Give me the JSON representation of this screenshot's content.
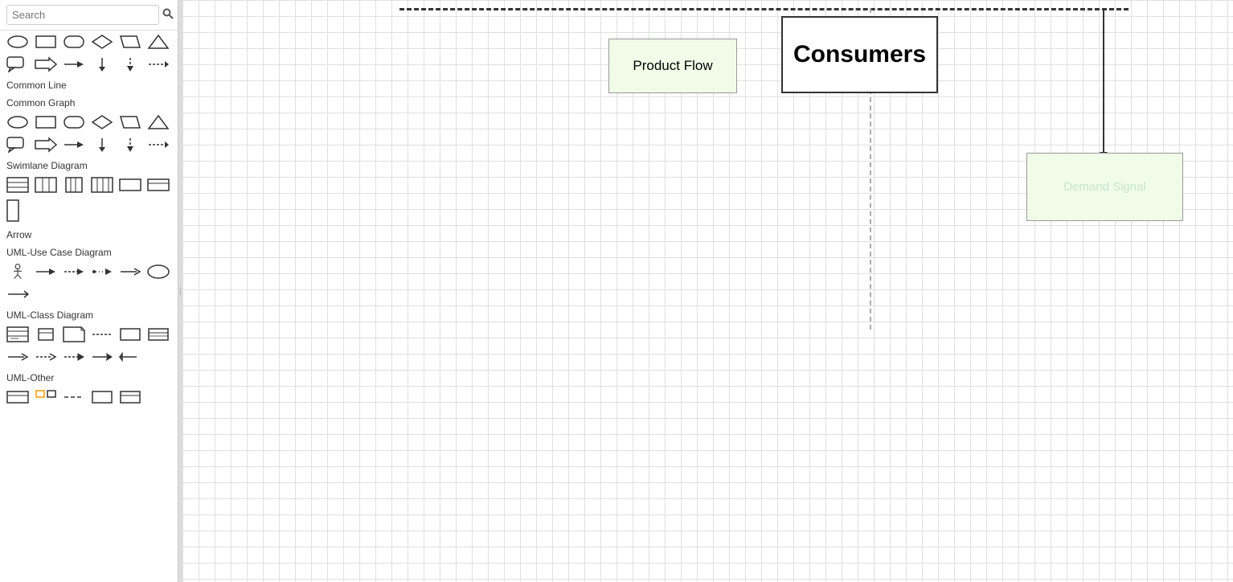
{
  "sidebar": {
    "search_placeholder": "Search",
    "sections": [
      {
        "id": "common-line",
        "label": "Common Line"
      },
      {
        "id": "common-graph",
        "label": "Common Graph"
      },
      {
        "id": "swimlane",
        "label": "Swimlane Diagram"
      },
      {
        "id": "arrow",
        "label": "Arrow"
      },
      {
        "id": "uml-use-case",
        "label": "UML-Use Case Diagram"
      },
      {
        "id": "uml-class",
        "label": "UML-Class Diagram"
      },
      {
        "id": "uml-other",
        "label": "UML-Other"
      }
    ]
  },
  "canvas": {
    "nodes": [
      {
        "id": "product-flow",
        "label": "Product Flow"
      },
      {
        "id": "consumers",
        "label": "Consumers"
      },
      {
        "id": "demand-signal",
        "label": "Demand Signal"
      }
    ]
  }
}
